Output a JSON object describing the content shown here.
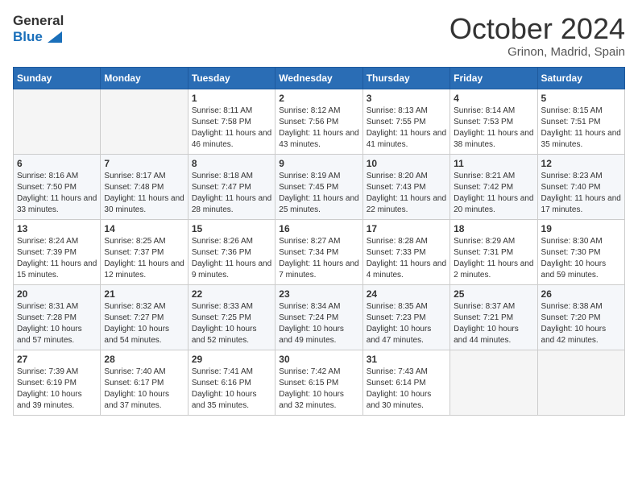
{
  "header": {
    "logo_general": "General",
    "logo_blue": "Blue",
    "month": "October 2024",
    "location": "Grinon, Madrid, Spain"
  },
  "days_of_week": [
    "Sunday",
    "Monday",
    "Tuesday",
    "Wednesday",
    "Thursday",
    "Friday",
    "Saturday"
  ],
  "weeks": [
    [
      {
        "day": "",
        "info": ""
      },
      {
        "day": "",
        "info": ""
      },
      {
        "day": "1",
        "info": "Sunrise: 8:11 AM\nSunset: 7:58 PM\nDaylight: 11 hours and 46 minutes."
      },
      {
        "day": "2",
        "info": "Sunrise: 8:12 AM\nSunset: 7:56 PM\nDaylight: 11 hours and 43 minutes."
      },
      {
        "day": "3",
        "info": "Sunrise: 8:13 AM\nSunset: 7:55 PM\nDaylight: 11 hours and 41 minutes."
      },
      {
        "day": "4",
        "info": "Sunrise: 8:14 AM\nSunset: 7:53 PM\nDaylight: 11 hours and 38 minutes."
      },
      {
        "day": "5",
        "info": "Sunrise: 8:15 AM\nSunset: 7:51 PM\nDaylight: 11 hours and 35 minutes."
      }
    ],
    [
      {
        "day": "6",
        "info": "Sunrise: 8:16 AM\nSunset: 7:50 PM\nDaylight: 11 hours and 33 minutes."
      },
      {
        "day": "7",
        "info": "Sunrise: 8:17 AM\nSunset: 7:48 PM\nDaylight: 11 hours and 30 minutes."
      },
      {
        "day": "8",
        "info": "Sunrise: 8:18 AM\nSunset: 7:47 PM\nDaylight: 11 hours and 28 minutes."
      },
      {
        "day": "9",
        "info": "Sunrise: 8:19 AM\nSunset: 7:45 PM\nDaylight: 11 hours and 25 minutes."
      },
      {
        "day": "10",
        "info": "Sunrise: 8:20 AM\nSunset: 7:43 PM\nDaylight: 11 hours and 22 minutes."
      },
      {
        "day": "11",
        "info": "Sunrise: 8:21 AM\nSunset: 7:42 PM\nDaylight: 11 hours and 20 minutes."
      },
      {
        "day": "12",
        "info": "Sunrise: 8:23 AM\nSunset: 7:40 PM\nDaylight: 11 hours and 17 minutes."
      }
    ],
    [
      {
        "day": "13",
        "info": "Sunrise: 8:24 AM\nSunset: 7:39 PM\nDaylight: 11 hours and 15 minutes."
      },
      {
        "day": "14",
        "info": "Sunrise: 8:25 AM\nSunset: 7:37 PM\nDaylight: 11 hours and 12 minutes."
      },
      {
        "day": "15",
        "info": "Sunrise: 8:26 AM\nSunset: 7:36 PM\nDaylight: 11 hours and 9 minutes."
      },
      {
        "day": "16",
        "info": "Sunrise: 8:27 AM\nSunset: 7:34 PM\nDaylight: 11 hours and 7 minutes."
      },
      {
        "day": "17",
        "info": "Sunrise: 8:28 AM\nSunset: 7:33 PM\nDaylight: 11 hours and 4 minutes."
      },
      {
        "day": "18",
        "info": "Sunrise: 8:29 AM\nSunset: 7:31 PM\nDaylight: 11 hours and 2 minutes."
      },
      {
        "day": "19",
        "info": "Sunrise: 8:30 AM\nSunset: 7:30 PM\nDaylight: 10 hours and 59 minutes."
      }
    ],
    [
      {
        "day": "20",
        "info": "Sunrise: 8:31 AM\nSunset: 7:28 PM\nDaylight: 10 hours and 57 minutes."
      },
      {
        "day": "21",
        "info": "Sunrise: 8:32 AM\nSunset: 7:27 PM\nDaylight: 10 hours and 54 minutes."
      },
      {
        "day": "22",
        "info": "Sunrise: 8:33 AM\nSunset: 7:25 PM\nDaylight: 10 hours and 52 minutes."
      },
      {
        "day": "23",
        "info": "Sunrise: 8:34 AM\nSunset: 7:24 PM\nDaylight: 10 hours and 49 minutes."
      },
      {
        "day": "24",
        "info": "Sunrise: 8:35 AM\nSunset: 7:23 PM\nDaylight: 10 hours and 47 minutes."
      },
      {
        "day": "25",
        "info": "Sunrise: 8:37 AM\nSunset: 7:21 PM\nDaylight: 10 hours and 44 minutes."
      },
      {
        "day": "26",
        "info": "Sunrise: 8:38 AM\nSunset: 7:20 PM\nDaylight: 10 hours and 42 minutes."
      }
    ],
    [
      {
        "day": "27",
        "info": "Sunrise: 7:39 AM\nSunset: 6:19 PM\nDaylight: 10 hours and 39 minutes."
      },
      {
        "day": "28",
        "info": "Sunrise: 7:40 AM\nSunset: 6:17 PM\nDaylight: 10 hours and 37 minutes."
      },
      {
        "day": "29",
        "info": "Sunrise: 7:41 AM\nSunset: 6:16 PM\nDaylight: 10 hours and 35 minutes."
      },
      {
        "day": "30",
        "info": "Sunrise: 7:42 AM\nSunset: 6:15 PM\nDaylight: 10 hours and 32 minutes."
      },
      {
        "day": "31",
        "info": "Sunrise: 7:43 AM\nSunset: 6:14 PM\nDaylight: 10 hours and 30 minutes."
      },
      {
        "day": "",
        "info": ""
      },
      {
        "day": "",
        "info": ""
      }
    ]
  ]
}
